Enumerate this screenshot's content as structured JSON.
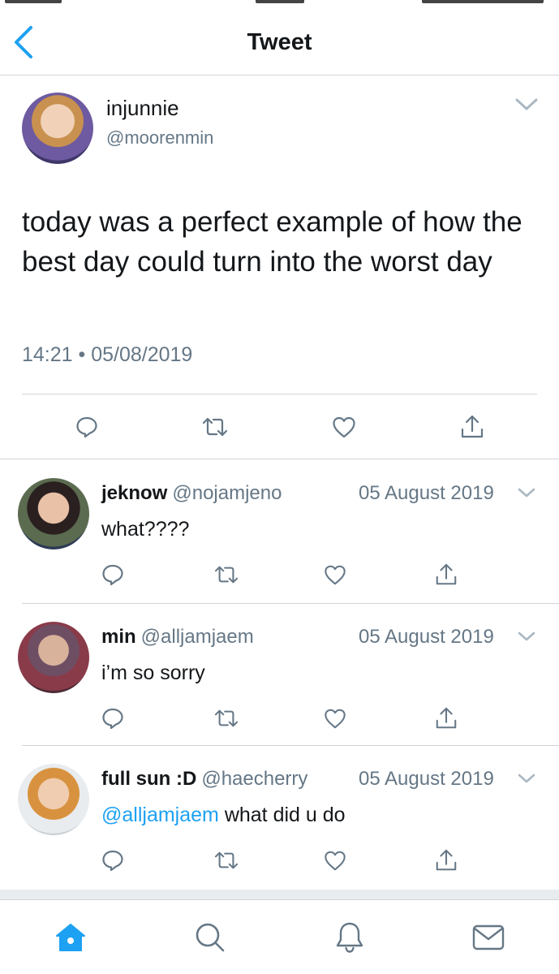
{
  "header": {
    "title": "Tweet"
  },
  "tweet": {
    "display_name": "injunnie",
    "handle": "@moorenmin",
    "text": "today was a perfect example of how the best day could turn into the worst day",
    "timestamp": "14:21 • 05/08/2019"
  },
  "replies": [
    {
      "display_name": "jeknow",
      "handle": "@nojamjeno",
      "date": "05 August 2019",
      "mention": "",
      "text": "what????"
    },
    {
      "display_name": "min",
      "handle": "@alljamjaem",
      "date": "05 August 2019",
      "mention": "",
      "text": "i’m so sorry"
    },
    {
      "display_name": "full sun :D",
      "handle": "@haecherry",
      "date": "05 August 2019",
      "mention": "@alljamjaem",
      "text": " what did u do"
    }
  ],
  "icons": {
    "back": "chevron-left-icon",
    "caret": "chevron-down-icon",
    "reply": "reply-bubble-icon",
    "retweet": "retweet-icon",
    "like": "heart-icon",
    "share": "share-icon",
    "tabs": [
      "home-icon",
      "search-icon",
      "notifications-bell-icon",
      "messages-envelope-icon"
    ]
  },
  "colors": {
    "accent": "#1da1f2",
    "text_primary": "#14171a",
    "text_secondary": "#657786",
    "divider": "#d0d4d8",
    "icon_gray": "#657786"
  },
  "tabbar": {
    "active_tab": "home"
  }
}
